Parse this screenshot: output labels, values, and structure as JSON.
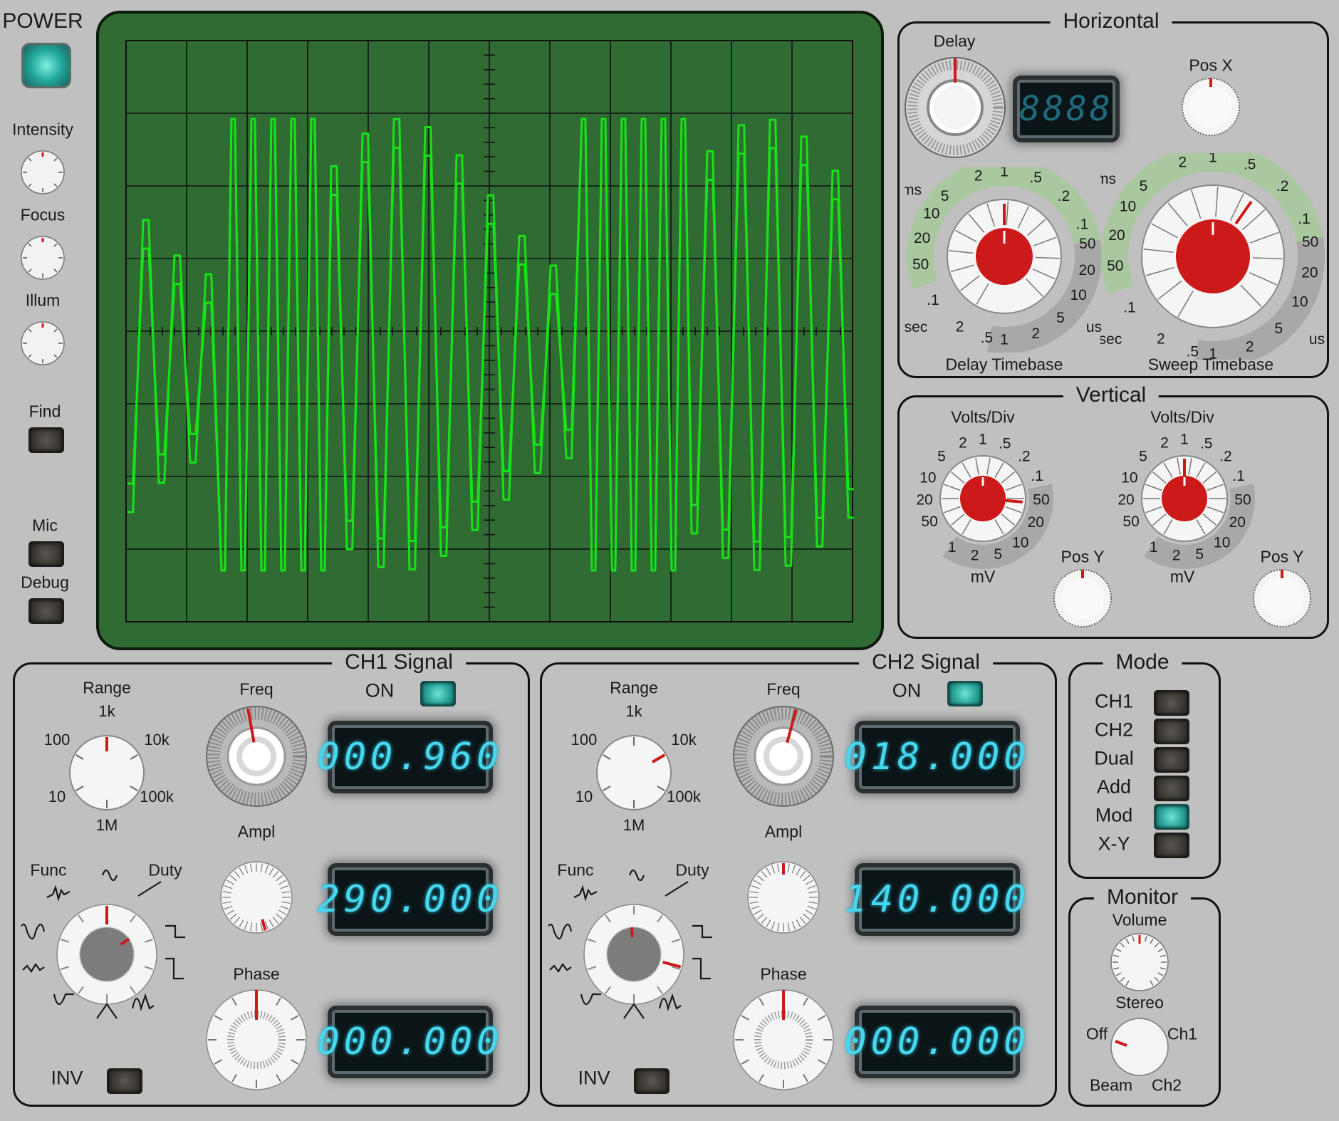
{
  "left_controls": {
    "power": "POWER",
    "intensity": "Intensity",
    "focus": "Focus",
    "illum": "Illum",
    "find": "Find",
    "mic": "Mic",
    "debug": "Debug"
  },
  "horizontal": {
    "title": "Horizontal",
    "delay": "Delay",
    "delay_display": "8888",
    "pos_x": "Pos X",
    "delay_timebase": "Delay Timebase",
    "sweep_timebase": "Sweep Timebase",
    "units": {
      "ms": "ms",
      "sec": "sec",
      "us": "us"
    },
    "scale_ms": [
      "5",
      "2",
      "1",
      ".5",
      ".2",
      ".1"
    ],
    "scale_ms_low": [
      "10",
      "20",
      "50"
    ],
    "scale_sec": [
      ".1",
      "2",
      ".5"
    ],
    "scale_us": [
      "1",
      "2",
      "5",
      "10",
      "20",
      "50"
    ]
  },
  "vertical": {
    "title": "Vertical",
    "volts_div": "Volts/Div",
    "mv": "mV",
    "pos_y": "Pos Y",
    "scale_v": [
      "5",
      "2",
      "1",
      ".5",
      ".2",
      ".1"
    ],
    "scale_v_low": [
      "10",
      "20",
      "50"
    ],
    "scale_mv": [
      "1",
      "2",
      "5",
      "10",
      "20",
      "50"
    ]
  },
  "ch1": {
    "title": "CH1 Signal",
    "on_label": "ON",
    "range": "Range",
    "range_marks": [
      "1k",
      "100",
      "10k",
      "10",
      "100k",
      "1M"
    ],
    "freq": "Freq",
    "ampl": "Ampl",
    "phase": "Phase",
    "func": "Func",
    "duty": "Duty",
    "inv": "INV",
    "freq_display": "000.960",
    "ampl_display": "290.000",
    "phase_display": "000.000"
  },
  "ch2": {
    "title": "CH2 Signal",
    "on_label": "ON",
    "range": "Range",
    "range_marks": [
      "1k",
      "100",
      "10k",
      "10",
      "100k",
      "1M"
    ],
    "freq": "Freq",
    "ampl": "Ampl",
    "phase": "Phase",
    "func": "Func",
    "duty": "Duty",
    "inv": "INV",
    "freq_display": "018.000",
    "ampl_display": "140.000",
    "phase_display": "000.000"
  },
  "mode": {
    "title": "Mode",
    "items": [
      "CH1",
      "CH2",
      "Dual",
      "Add",
      "Mod",
      "X-Y"
    ],
    "active": "Mod"
  },
  "monitor": {
    "title": "Monitor",
    "volume": "Volume",
    "stereo": "Stereo",
    "off": "Off",
    "ch1": "Ch1",
    "beam": "Beam",
    "ch2": "Ch2"
  },
  "colors": {
    "screen": "#2f6b33",
    "trace": "#19e019",
    "knob_red": "#cc1a1a",
    "scale_green": "#a9c8a0",
    "lcd_text": "#45d8ee"
  }
}
